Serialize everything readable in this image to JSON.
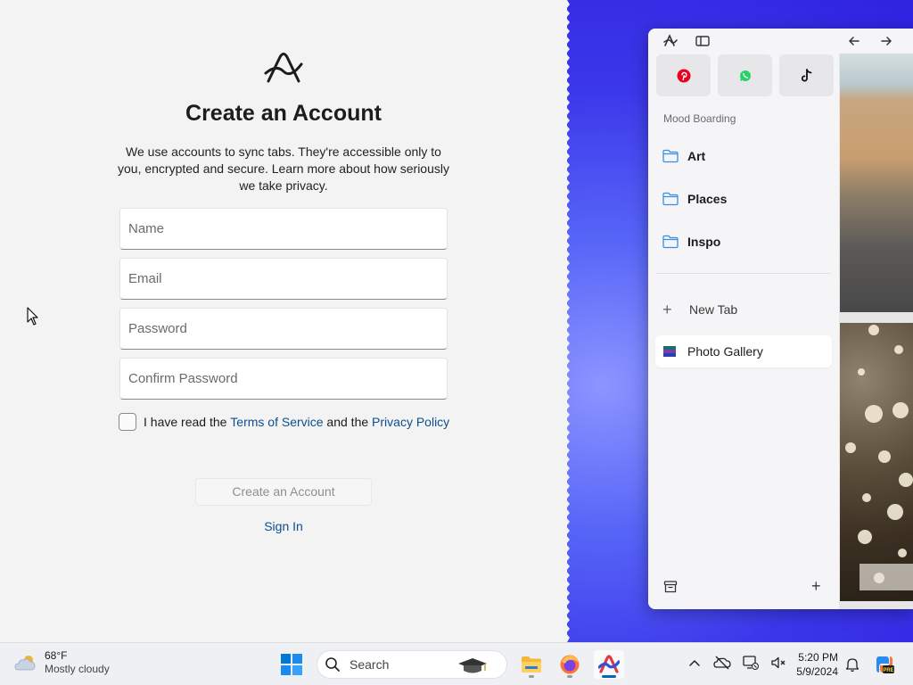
{
  "signup": {
    "title": "Create an Account",
    "description": "We use accounts to sync tabs. They're accessible only to you, encrypted and secure. Learn more about how seriously we take privacy.",
    "fields": {
      "name_placeholder": "Name",
      "email_placeholder": "Email",
      "password_placeholder": "Password",
      "confirm_placeholder": "Confirm Password"
    },
    "terms": {
      "prefix": "I have read the ",
      "tos_link": "Terms of Service",
      "middle": " and the ",
      "privacy_link": "Privacy Policy",
      "checked": false
    },
    "create_button": "Create an Account",
    "sign_in_link": "Sign In"
  },
  "arc": {
    "pinned": [
      {
        "icon": "pinterest-icon",
        "color": "#e60023"
      },
      {
        "icon": "whatsapp-icon",
        "color": "#25d366"
      },
      {
        "icon": "tiktok-icon",
        "color": "#111111"
      }
    ],
    "section_label": "Mood Boarding",
    "folders": [
      {
        "label": "Art"
      },
      {
        "label": "Places"
      },
      {
        "label": "Inspo"
      }
    ],
    "new_tab_label": "New Tab",
    "active_tab_label": "Photo Gallery",
    "accent_folder": "#3a8ee6"
  },
  "taskbar": {
    "weather": {
      "temp": "68°F",
      "condition": "Mostly cloudy"
    },
    "search_label": "Search",
    "apps": [
      "file-explorer-icon",
      "firefox-icon",
      "arc-browser-icon"
    ],
    "clock": {
      "time": "5:20 PM",
      "date": "5/9/2024"
    }
  }
}
